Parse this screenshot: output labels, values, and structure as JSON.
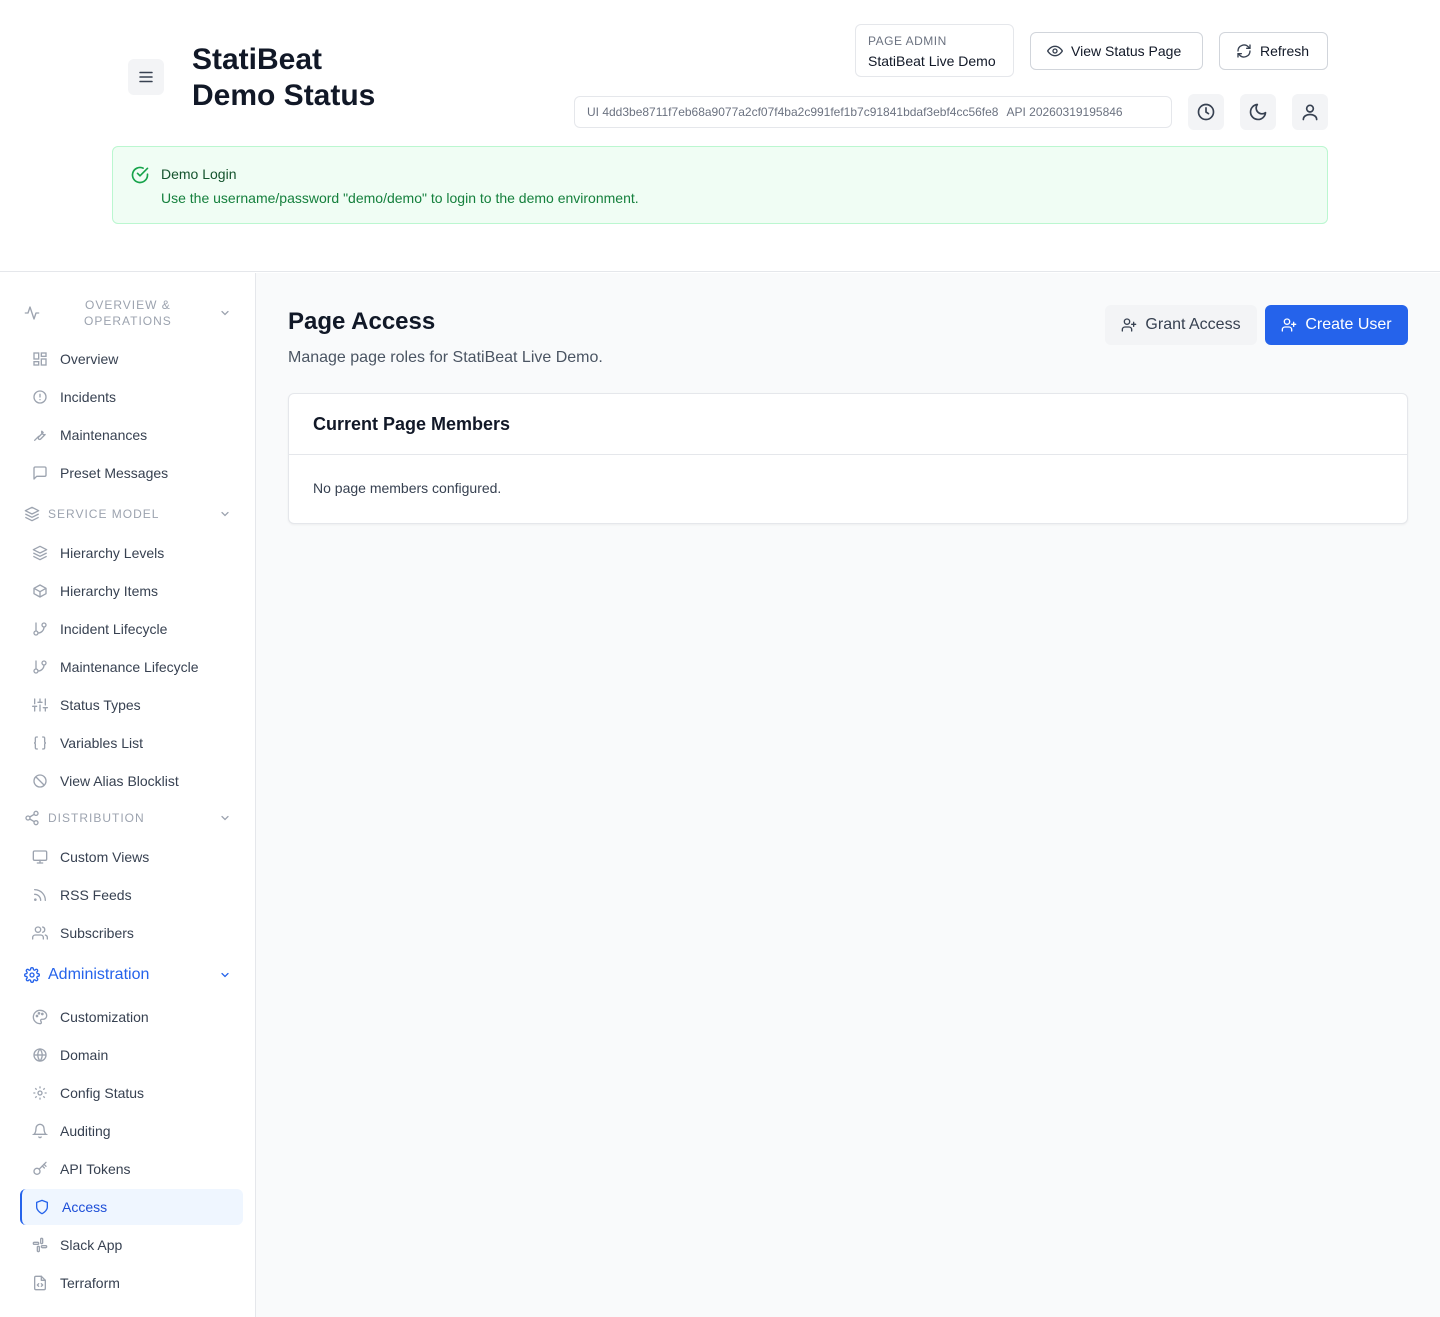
{
  "header": {
    "title_line1": "StatiBeat",
    "title_line2": "Demo Status",
    "page_admin_label": "PAGE ADMIN",
    "page_admin_value": "StatiBeat Live Demo",
    "view_status_label": "View Status Page",
    "refresh_label": "Refresh",
    "ui_version": "UI 4dd3be8711f7eb68a9077a2cf07f4ba2c991fef1b7c91841bdaf3ebf4cc56fe8",
    "api_version": "API 20260319195846"
  },
  "alert": {
    "title": "Demo Login",
    "description": "Use the username/password \"demo/demo\" to login to the demo environment."
  },
  "sidebar": {
    "sections": [
      {
        "label_line1": "OVERVIEW &",
        "label_line2": "OPERATIONS",
        "icon": "activity-icon",
        "items": [
          {
            "label": "Overview",
            "icon": "grid-icon"
          },
          {
            "label": "Incidents",
            "icon": "alert-circle-icon"
          },
          {
            "label": "Maintenances",
            "icon": "wrench-icon"
          },
          {
            "label": "Preset Messages",
            "icon": "message-square-icon"
          }
        ]
      },
      {
        "label": "SERVICE MODEL",
        "icon": "layers-icon",
        "items": [
          {
            "label": "Hierarchy Levels",
            "icon": "layers-icon"
          },
          {
            "label": "Hierarchy Items",
            "icon": "box-icon"
          },
          {
            "label": "Incident Lifecycle",
            "icon": "git-branch-icon"
          },
          {
            "label": "Maintenance Lifecycle",
            "icon": "git-branch-icon"
          },
          {
            "label": "Status Types",
            "icon": "sliders-icon"
          },
          {
            "label": "Variables List",
            "icon": "braces-icon"
          },
          {
            "label": "View Alias Blocklist",
            "icon": "ban-icon"
          }
        ]
      },
      {
        "label": "DISTRIBUTION",
        "icon": "share-icon",
        "items": [
          {
            "label": "Custom Views",
            "icon": "monitor-icon"
          },
          {
            "label": "RSS Feeds",
            "icon": "rss-icon"
          },
          {
            "label": "Subscribers",
            "icon": "users-icon"
          }
        ]
      },
      {
        "label": "Administration",
        "icon": "gear-icon",
        "items": [
          {
            "label": "Customization",
            "icon": "palette-icon"
          },
          {
            "label": "Domain",
            "icon": "globe-icon"
          },
          {
            "label": "Config Status",
            "icon": "gear-icon"
          },
          {
            "label": "Auditing",
            "icon": "bell-icon"
          },
          {
            "label": "API Tokens",
            "icon": "key-icon"
          },
          {
            "label": "Access",
            "icon": "shield-icon",
            "active": true
          },
          {
            "label": "Slack App",
            "icon": "slack-icon"
          },
          {
            "label": "Terraform",
            "icon": "file-code-icon"
          }
        ]
      }
    ]
  },
  "main": {
    "title": "Page Access",
    "subtitle": "Manage page roles for StatiBeat Live Demo.",
    "grant_label": "Grant Access",
    "create_label": "Create User",
    "card_title": "Current Page Members",
    "empty_text": "No page members configured."
  },
  "colors": {
    "accent": "#2563eb",
    "alert_bg": "#f0fdf4",
    "alert_text": "#15803d"
  }
}
